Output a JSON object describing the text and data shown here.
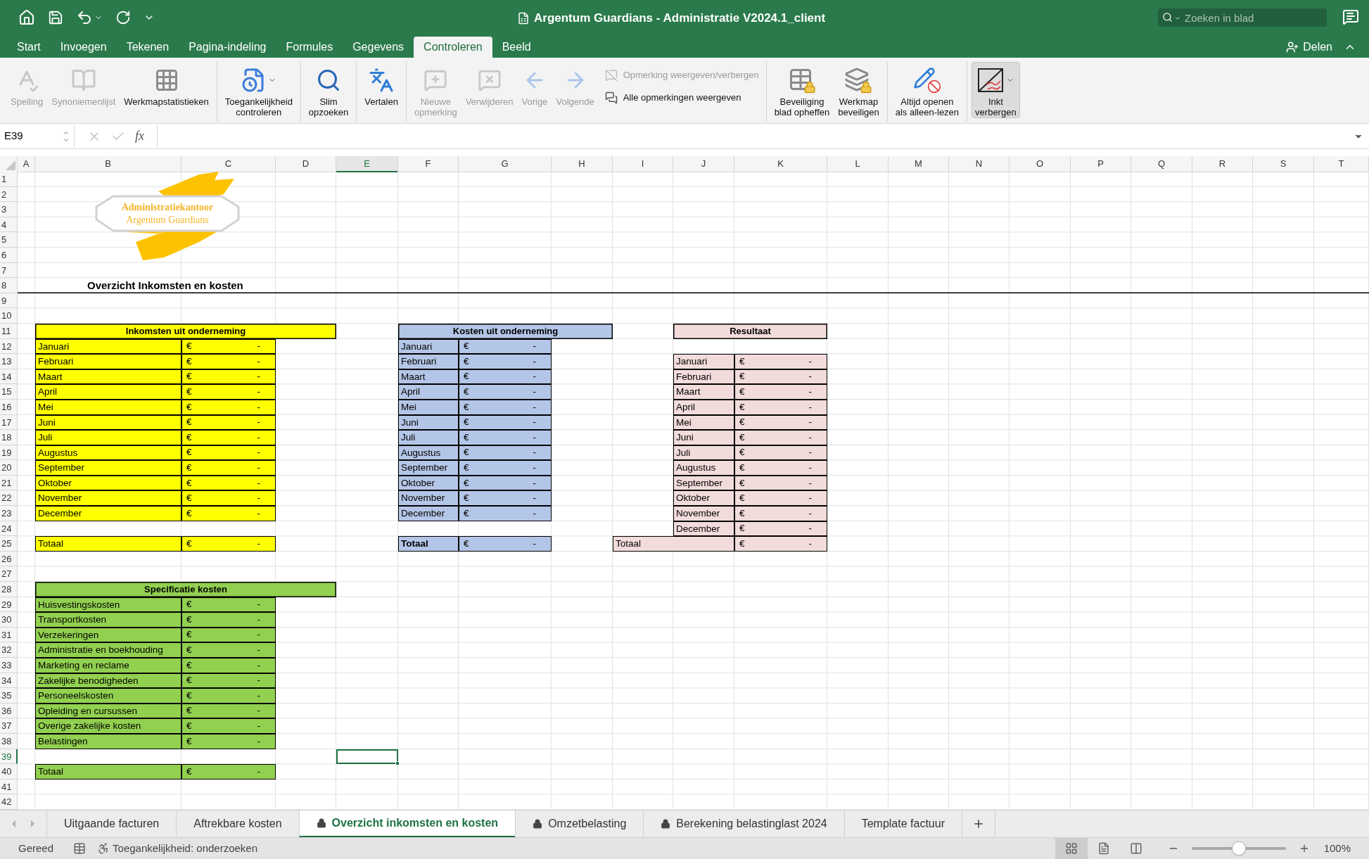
{
  "window": {
    "title": "Argentum Guardians - Administratie V2024.1_client",
    "search": {
      "placeholder": "Zoeken in blad"
    }
  },
  "menu_tabs": [
    {
      "label": "Start",
      "selected": false
    },
    {
      "label": "Invoegen",
      "selected": false
    },
    {
      "label": "Tekenen",
      "selected": false
    },
    {
      "label": "Pagina-indeling",
      "selected": false
    },
    {
      "label": "Formules",
      "selected": false
    },
    {
      "label": "Gegevens",
      "selected": false
    },
    {
      "label": "Controleren",
      "selected": true
    },
    {
      "label": "Beeld",
      "selected": false
    }
  ],
  "share_button": "Delen",
  "ribbon": {
    "groups": [
      {
        "items": [
          {
            "kind": "large",
            "label": "Spelling",
            "disabled": true
          },
          {
            "kind": "large",
            "label": "Synoniemenlijst",
            "disabled": true
          },
          {
            "kind": "large",
            "label": "Werkmapstatistieken",
            "disabled": false
          }
        ]
      },
      {
        "items": [
          {
            "kind": "large",
            "label": "Toegankelijkheid\ncontroleren",
            "disabled": false,
            "dropdown": true
          }
        ]
      },
      {
        "items": [
          {
            "kind": "large",
            "label": "Slim\nopzoeken",
            "disabled": false
          }
        ]
      },
      {
        "items": [
          {
            "kind": "large",
            "label": "Vertalen",
            "disabled": false
          }
        ]
      },
      {
        "items": [
          {
            "kind": "large",
            "label": "Nieuwe\nopmerking",
            "disabled": true
          },
          {
            "kind": "large",
            "label": "Verwijderen",
            "disabled": true
          },
          {
            "kind": "large",
            "label": "Vorige",
            "disabled": true
          },
          {
            "kind": "large",
            "label": "Volgende",
            "disabled": true
          },
          {
            "kind": "small",
            "label": "Opmerking weergeven/verbergen",
            "disabled": true
          },
          {
            "kind": "small",
            "label": "Alle opmerkingen weergeven",
            "disabled": false
          }
        ]
      },
      {
        "items": [
          {
            "kind": "large",
            "label": "Beveiliging\nblad opheffen",
            "disabled": false
          },
          {
            "kind": "large",
            "label": "Werkmap\nbeveiligen",
            "disabled": false
          }
        ]
      },
      {
        "items": [
          {
            "kind": "large",
            "label": "Altijd openen\nals alleen-lezen",
            "disabled": false
          }
        ]
      },
      {
        "items": [
          {
            "kind": "large",
            "label": "Inkt\nverbergen",
            "disabled": false,
            "on": true,
            "dropdown": true
          }
        ]
      }
    ]
  },
  "formula_bar": {
    "name_box": "E39",
    "function_label": "fx"
  },
  "sheet": {
    "columns": [
      {
        "label": "A",
        "selected": false
      },
      {
        "label": "B",
        "selected": false
      },
      {
        "label": "C",
        "selected": false
      },
      {
        "label": "D",
        "selected": false
      },
      {
        "label": "E",
        "selected": true
      },
      {
        "label": "F",
        "selected": false
      },
      {
        "label": "G",
        "selected": false
      },
      {
        "label": "H",
        "selected": false
      },
      {
        "label": "I",
        "selected": false
      },
      {
        "label": "J",
        "selected": false
      },
      {
        "label": "K",
        "selected": false
      },
      {
        "label": "L",
        "selected": false
      },
      {
        "label": "M",
        "selected": false
      },
      {
        "label": "N",
        "selected": false
      },
      {
        "label": "O",
        "selected": false
      },
      {
        "label": "P",
        "selected": false
      },
      {
        "label": "Q",
        "selected": false
      },
      {
        "label": "R",
        "selected": false
      },
      {
        "label": "S",
        "selected": false
      },
      {
        "label": "T",
        "selected": false
      }
    ],
    "rows": [
      {
        "label": "1",
        "selected": false
      },
      {
        "label": "2",
        "selected": false
      },
      {
        "label": "3",
        "selected": false
      },
      {
        "label": "4",
        "selected": false
      },
      {
        "label": "5",
        "selected": false
      },
      {
        "label": "6",
        "selected": false
      },
      {
        "label": "7",
        "selected": false
      },
      {
        "label": "8",
        "selected": false
      },
      {
        "label": "9",
        "selected": false
      },
      {
        "label": "10",
        "selected": false
      },
      {
        "label": "11",
        "selected": false
      },
      {
        "label": "12",
        "selected": false
      },
      {
        "label": "13",
        "selected": false
      },
      {
        "label": "14",
        "selected": false
      },
      {
        "label": "15",
        "selected": false
      },
      {
        "label": "16",
        "selected": false
      },
      {
        "label": "17",
        "selected": false
      },
      {
        "label": "18",
        "selected": false
      },
      {
        "label": "19",
        "selected": false
      },
      {
        "label": "20",
        "selected": false
      },
      {
        "label": "21",
        "selected": false
      },
      {
        "label": "22",
        "selected": false
      },
      {
        "label": "23",
        "selected": false
      },
      {
        "label": "24",
        "selected": false
      },
      {
        "label": "25",
        "selected": false
      },
      {
        "label": "26",
        "selected": false
      },
      {
        "label": "27",
        "selected": false
      },
      {
        "label": "28",
        "selected": false
      },
      {
        "label": "29",
        "selected": false
      },
      {
        "label": "30",
        "selected": false
      },
      {
        "label": "31",
        "selected": false
      },
      {
        "label": "32",
        "selected": false
      },
      {
        "label": "33",
        "selected": false
      },
      {
        "label": "34",
        "selected": false
      },
      {
        "label": "35",
        "selected": false
      },
      {
        "label": "36",
        "selected": false
      },
      {
        "label": "37",
        "selected": false
      },
      {
        "label": "38",
        "selected": false
      },
      {
        "label": "39",
        "selected": true
      },
      {
        "label": "40",
        "selected": false
      },
      {
        "label": "41",
        "selected": false
      },
      {
        "label": "42",
        "selected": false
      }
    ],
    "logo": {
      "line_1": "Administratiekantoor",
      "line_2": "Argentum Guardians"
    },
    "title": "Overzicht Inkomsten en kosten",
    "tables": [
      {
        "title": "Inkomsten uit onderneming",
        "color": "#ffff00",
        "rows": [
          {
            "label": "Januari",
            "currency": "€",
            "amount": "-"
          },
          {
            "label": "Februari",
            "currency": "€",
            "amount": "-"
          },
          {
            "label": "Maart",
            "currency": "€",
            "amount": "-"
          },
          {
            "label": "April",
            "currency": "€",
            "amount": "-"
          },
          {
            "label": "Mei",
            "currency": "€",
            "amount": "-"
          },
          {
            "label": "Juni",
            "currency": "€",
            "amount": "-"
          },
          {
            "label": "Juli",
            "currency": "€",
            "amount": "-"
          },
          {
            "label": "Augustus",
            "currency": "€",
            "amount": "-"
          },
          {
            "label": "September",
            "currency": "€",
            "amount": "-"
          },
          {
            "label": "Oktober",
            "currency": "€",
            "amount": "-"
          },
          {
            "label": "November",
            "currency": "€",
            "amount": "-"
          },
          {
            "label": "December",
            "currency": "€",
            "amount": "-"
          }
        ],
        "total": {
          "label": "Totaal",
          "currency": "€",
          "amount": "-",
          "bold": false
        }
      },
      {
        "title": "Kosten uit onderneming",
        "color": "#b4c6e7",
        "rows": [
          {
            "label": "Januari",
            "currency": "€",
            "amount": "-"
          },
          {
            "label": "Februari",
            "currency": "€",
            "amount": "-"
          },
          {
            "label": "Maart",
            "currency": "€",
            "amount": "-"
          },
          {
            "label": "April",
            "currency": "€",
            "amount": "-"
          },
          {
            "label": "Mei",
            "currency": "€",
            "amount": "-"
          },
          {
            "label": "Juni",
            "currency": "€",
            "amount": "-"
          },
          {
            "label": "Juli",
            "currency": "€",
            "amount": "-"
          },
          {
            "label": "Augustus",
            "currency": "€",
            "amount": "-"
          },
          {
            "label": "September",
            "currency": "€",
            "amount": "-"
          },
          {
            "label": "Oktober",
            "currency": "€",
            "amount": "-"
          },
          {
            "label": "November",
            "currency": "€",
            "amount": "-"
          },
          {
            "label": "December",
            "currency": "€",
            "amount": "-"
          }
        ],
        "total": {
          "label": "Totaal",
          "currency": "€",
          "amount": "-",
          "bold": true
        }
      },
      {
        "title": "Resultaat",
        "color": "#f2dcdb",
        "rows": [
          {
            "label": "Januari",
            "currency": "€",
            "amount": "-"
          },
          {
            "label": "Februari",
            "currency": "€",
            "amount": "-"
          },
          {
            "label": "Maart",
            "currency": "€",
            "amount": "-"
          },
          {
            "label": "April",
            "currency": "€",
            "amount": "-"
          },
          {
            "label": "Mei",
            "currency": "€",
            "amount": "-"
          },
          {
            "label": "Juni",
            "currency": "€",
            "amount": "-"
          },
          {
            "label": "Juli",
            "currency": "€",
            "amount": "-"
          },
          {
            "label": "Augustus",
            "currency": "€",
            "amount": "-"
          },
          {
            "label": "September",
            "currency": "€",
            "amount": "-"
          },
          {
            "label": "Oktober",
            "currency": "€",
            "amount": "-"
          },
          {
            "label": "November",
            "currency": "€",
            "amount": "-"
          },
          {
            "label": "December",
            "currency": "€",
            "amount": "-"
          }
        ],
        "total": {
          "label": "Totaal",
          "currency": "€",
          "amount": "-",
          "bold": false
        }
      },
      {
        "title": "Specificatie kosten",
        "color": "#92d050",
        "rows": [
          {
            "label": "Huisvestingskosten",
            "currency": "€",
            "amount": "-"
          },
          {
            "label": "Transportkosten",
            "currency": "€",
            "amount": "-"
          },
          {
            "label": "Verzekeringen",
            "currency": "€",
            "amount": "-"
          },
          {
            "label": "Administratie en boekhouding",
            "currency": "€",
            "amount": "-"
          },
          {
            "label": "Marketing en reclame",
            "currency": "€",
            "amount": "-"
          },
          {
            "label": "Zakelijke benodigheden",
            "currency": "€",
            "amount": "-"
          },
          {
            "label": "Personeelskosten",
            "currency": "€",
            "amount": "-"
          },
          {
            "label": "Opleiding en cursussen",
            "currency": "€",
            "amount": "-"
          },
          {
            "label": "Overige zakelijke kosten",
            "currency": "€",
            "amount": "-"
          },
          {
            "label": "Belastingen",
            "currency": "€",
            "amount": "-"
          }
        ],
        "total": {
          "label": "Totaal",
          "currency": "€",
          "amount": "-",
          "bold": false
        }
      }
    ]
  },
  "sheet_tabs": [
    {
      "label": "Uitgaande facturen",
      "selected": false,
      "locked": false
    },
    {
      "label": "Aftrekbare kosten",
      "selected": false,
      "locked": false
    },
    {
      "label": "Overzicht inkomsten en kosten",
      "selected": true,
      "locked": true
    },
    {
      "label": "Omzetbelasting",
      "selected": false,
      "locked": true
    },
    {
      "label": "Berekening belastinglast 2024",
      "selected": false,
      "locked": true
    },
    {
      "label": "Template factuur",
      "selected": false,
      "locked": false
    }
  ],
  "status_bar": {
    "status": "Gereed",
    "accessibility": "Toegankelijkheid: onderzoeken",
    "views": [
      {
        "selected": true
      },
      {
        "selected": false
      },
      {
        "selected": false
      }
    ],
    "zoom": {
      "level": 0.5,
      "reading": "100%"
    }
  }
}
